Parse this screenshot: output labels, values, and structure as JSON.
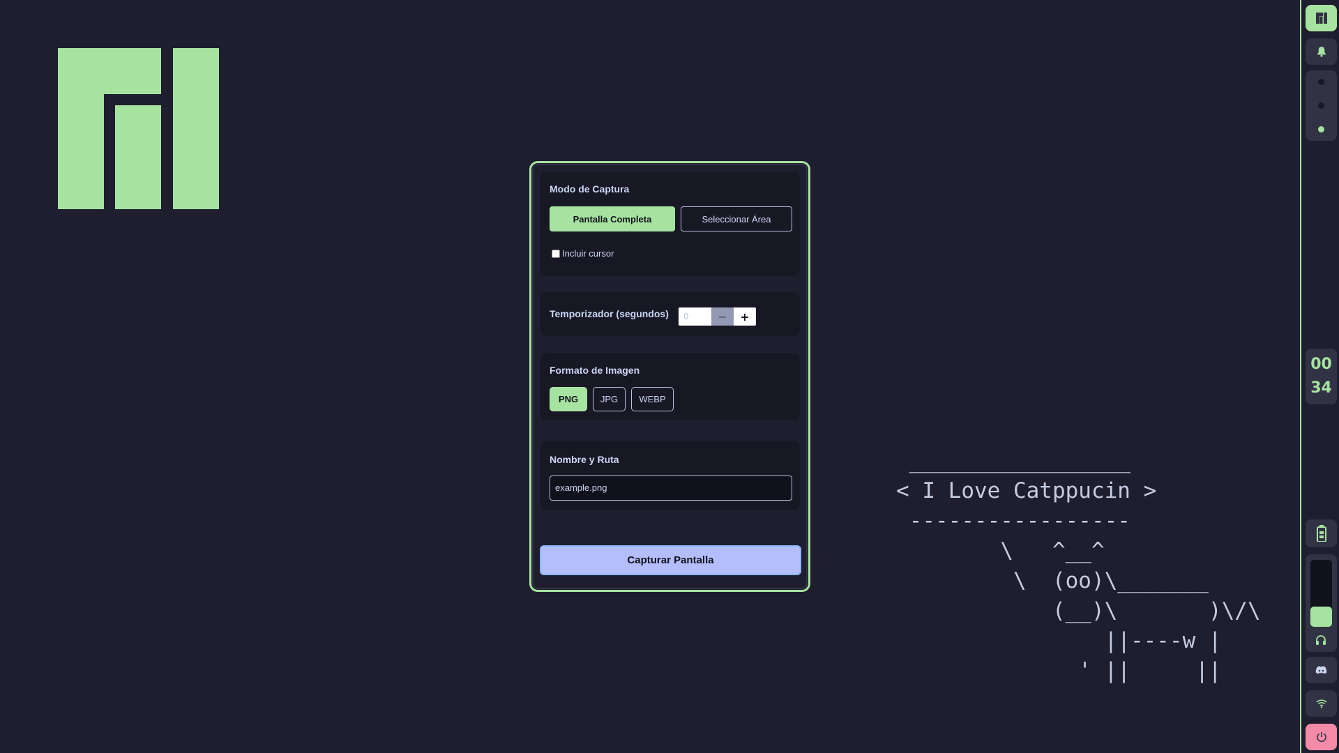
{
  "dialog": {
    "capture_mode": {
      "title": "Modo de Captura",
      "options": [
        "Pantalla Completa",
        "Seleccionar Área"
      ],
      "selected": "Pantalla Completa",
      "cursor_label": "Incluir cursor",
      "cursor_checked": false
    },
    "timer": {
      "title": "Temporizador (segundos)",
      "value": "0",
      "minus": "−",
      "plus": "+"
    },
    "format": {
      "title": "Formato de Imagen",
      "options": [
        "PNG",
        "JPG",
        "WEBP"
      ],
      "selected": "PNG"
    },
    "path": {
      "title": "Nombre y Ruta",
      "value": "example.png"
    },
    "capture_label": "Capturar Pantalla"
  },
  "ascii_art": " _________________\n< I Love Catppucin >\n -----------------\n        \\   ^__^\n         \\  (oo)\\_______\n            (__)\\       )\\/\\\n                ||----w |\n              ' ||     ||",
  "statusbar": {
    "clock_hours": "00",
    "clock_minutes": "34",
    "workspaces_active_index": 2,
    "volume_fraction": 0.3,
    "icons": [
      "manjaro-icon",
      "bell-icon",
      "battery-icon",
      "headphones-icon",
      "discord-icon",
      "wifi-icon",
      "power-icon"
    ]
  },
  "colors": {
    "background": "#1e1e2e",
    "accent_green": "#a6e3a1",
    "accent_lavender": "#b4befe",
    "power_pink": "#f38ba8"
  }
}
